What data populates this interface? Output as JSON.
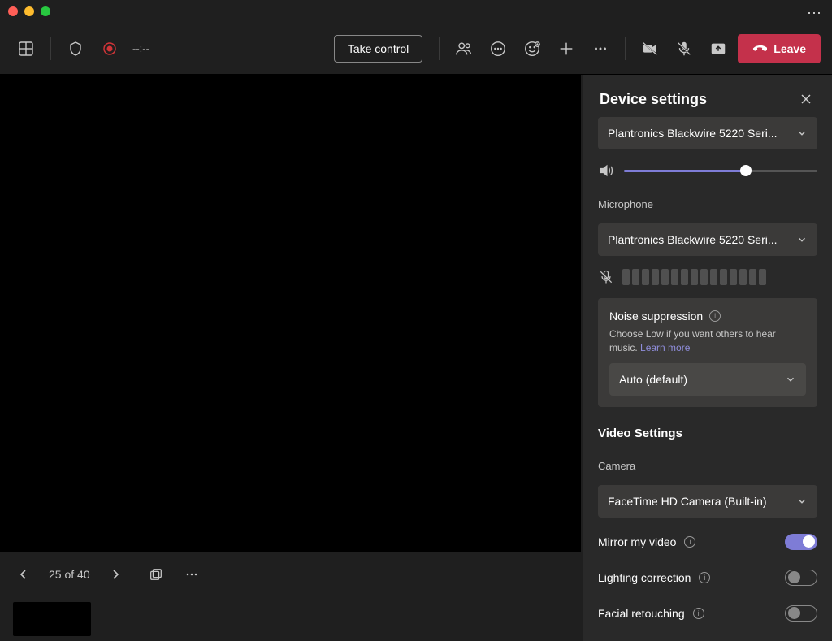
{
  "titlebar": {},
  "toolbar": {
    "time": "--:--",
    "take_control": "Take control",
    "leave": "Leave"
  },
  "footer": {
    "page_label": "25 of 40"
  },
  "panel": {
    "title": "Device settings",
    "speaker_device": "Plantronics Blackwire 5220 Seri...",
    "speaker_volume_pct": 63,
    "mic_label": "Microphone",
    "mic_device": "Plantronics Blackwire 5220 Seri...",
    "noise": {
      "title": "Noise suppression",
      "desc_prefix": "Choose Low if you want others to hear music. ",
      "learn_more": "Learn more",
      "value": "Auto (default)"
    },
    "video": {
      "section": "Video Settings",
      "camera_label": "Camera",
      "camera_value": "FaceTime HD Camera (Built-in)",
      "mirror": {
        "label": "Mirror my video",
        "on": true
      },
      "lighting": {
        "label": "Lighting correction",
        "on": false
      },
      "facial": {
        "label": "Facial retouching",
        "on": false
      }
    }
  }
}
